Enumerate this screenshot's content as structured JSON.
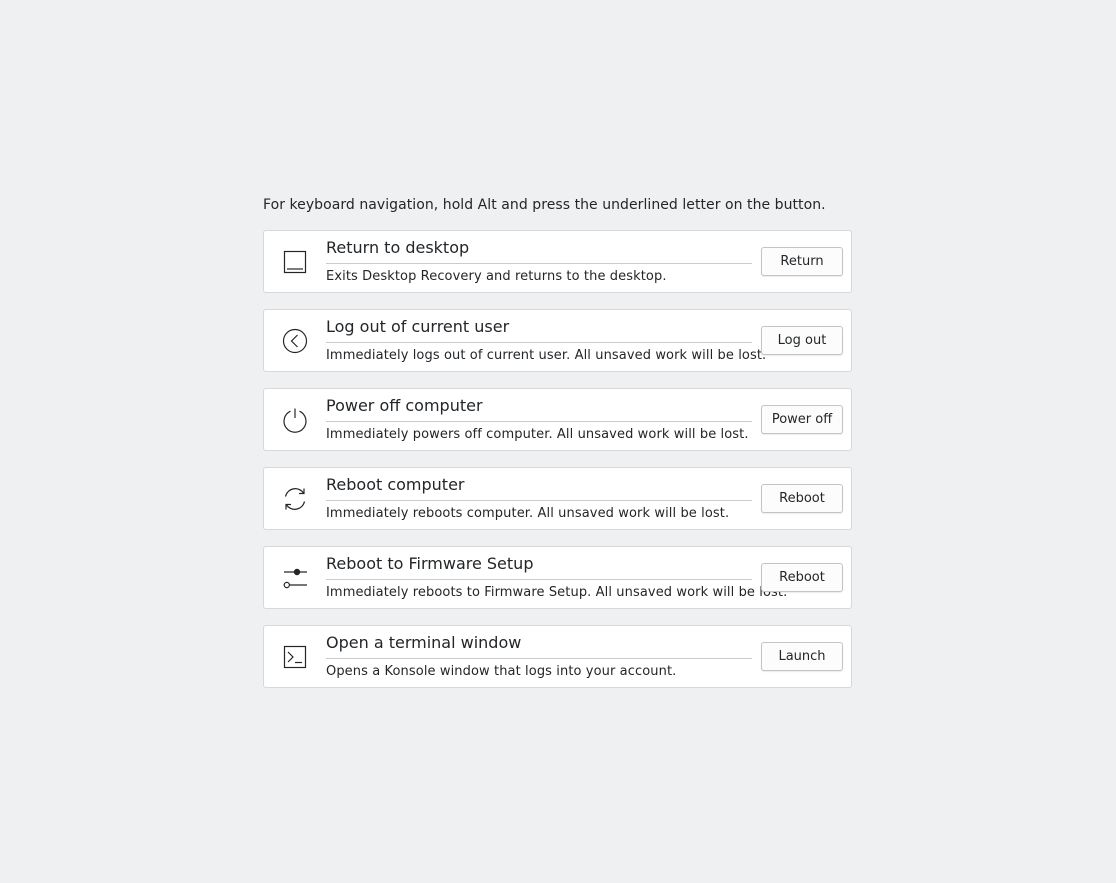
{
  "hint": "For keyboard navigation, hold Alt and press the underlined letter on the button.",
  "actions": [
    {
      "icon": "desktop-icon",
      "title": "Return to desktop",
      "description": "Exits Desktop Recovery and returns to the desktop.",
      "button": "Return"
    },
    {
      "icon": "logout-icon",
      "title": "Log out of current user",
      "description": "Immediately logs out of current user. All unsaved work will be lost.",
      "button": "Log out"
    },
    {
      "icon": "power-icon",
      "title": "Power off computer",
      "description": "Immediately powers off computer. All unsaved work will be lost.",
      "button": "Power off"
    },
    {
      "icon": "reboot-icon",
      "title": "Reboot computer",
      "description": "Immediately reboots computer. All unsaved work will be lost.",
      "button": "Reboot"
    },
    {
      "icon": "firmware-settings-icon",
      "title": "Reboot to Firmware Setup",
      "description": "Immediately reboots to Firmware Setup. All unsaved work will be lost.",
      "button": "Reboot"
    },
    {
      "icon": "terminal-icon",
      "title": "Open a terminal window",
      "description": "Opens a Konsole window that logs into your account.",
      "button": "Launch"
    }
  ]
}
